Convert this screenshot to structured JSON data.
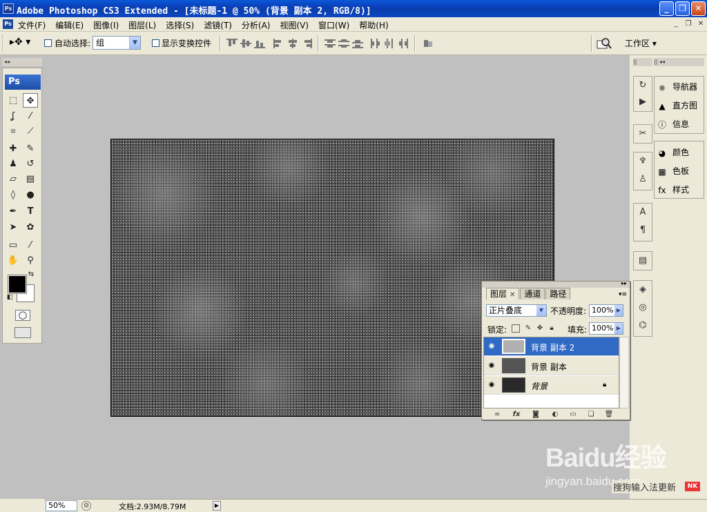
{
  "window": {
    "title": "Adobe Photoshop CS3 Extended - [未标题-1 @ 50% (背景 副本 2, RGB/8)]",
    "app_icon": "Ps"
  },
  "menu": {
    "items": [
      "文件(F)",
      "编辑(E)",
      "图像(I)",
      "图层(L)",
      "选择(S)",
      "滤镜(T)",
      "分析(A)",
      "视图(V)",
      "窗口(W)",
      "帮助(H)"
    ]
  },
  "options": {
    "auto_select_label": "自动选择:",
    "auto_select_value": "组",
    "show_transform_label": "显示变换控件",
    "workspace_label": "工作区 ▾"
  },
  "toolbox": {
    "logo": "Ps"
  },
  "dock": {
    "named_items": [
      {
        "label": "导航器",
        "icon": "navigator-icon"
      },
      {
        "label": "直方图",
        "icon": "histogram-icon"
      },
      {
        "label": "信息",
        "icon": "info-icon"
      },
      {
        "label": "颜色",
        "icon": "color-icon"
      },
      {
        "label": "色板",
        "icon": "swatches-icon"
      },
      {
        "label": "样式",
        "icon": "styles-icon"
      }
    ]
  },
  "layers_panel": {
    "tabs": [
      "图层",
      "通道",
      "路径"
    ],
    "blend_mode": "正片叠底",
    "opacity_label": "不透明度:",
    "opacity_value": "100%",
    "lock_label": "锁定:",
    "fill_label": "填充:",
    "fill_value": "100%",
    "layers": [
      {
        "name": "背景 副本 2",
        "selected": true,
        "locked": false
      },
      {
        "name": "背景 副本",
        "selected": false,
        "locked": false
      },
      {
        "name": "背景",
        "selected": false,
        "locked": true
      }
    ]
  },
  "status": {
    "zoom": "50%",
    "doc_info": "文档:2.93M/8.79M"
  },
  "watermark": {
    "logo": "Baidu经验",
    "url": "jingyan.baidu.com",
    "strip_text": "搜狗输入法更新",
    "badge": "NK"
  },
  "colors": {
    "foreground": "#000000",
    "background": "#ffffff",
    "selection": "#316ac5",
    "titlebar": "#0a3fb8"
  }
}
